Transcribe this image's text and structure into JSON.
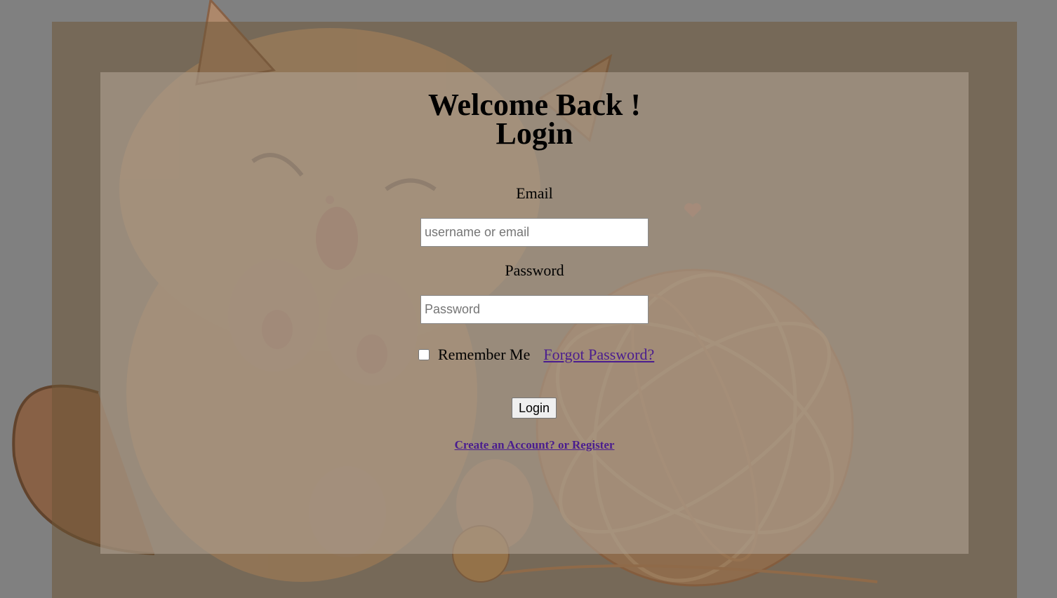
{
  "login": {
    "heading_line1": "Welcome Back !",
    "heading_line2": "Login",
    "email_label": "Email",
    "email_placeholder": "username or email",
    "email_value": "",
    "password_label": "Password",
    "password_placeholder": "Password",
    "password_value": "",
    "remember_label": "Remember Me",
    "remember_checked": false,
    "forgot_link": "Forgot Password?",
    "submit_label": "Login",
    "register_link": "Create an Account? or Register"
  },
  "theme": {
    "page_background": "#808080",
    "link_color": "#4a1d8f",
    "background_art": "kitten-with-yarn-illustration"
  }
}
